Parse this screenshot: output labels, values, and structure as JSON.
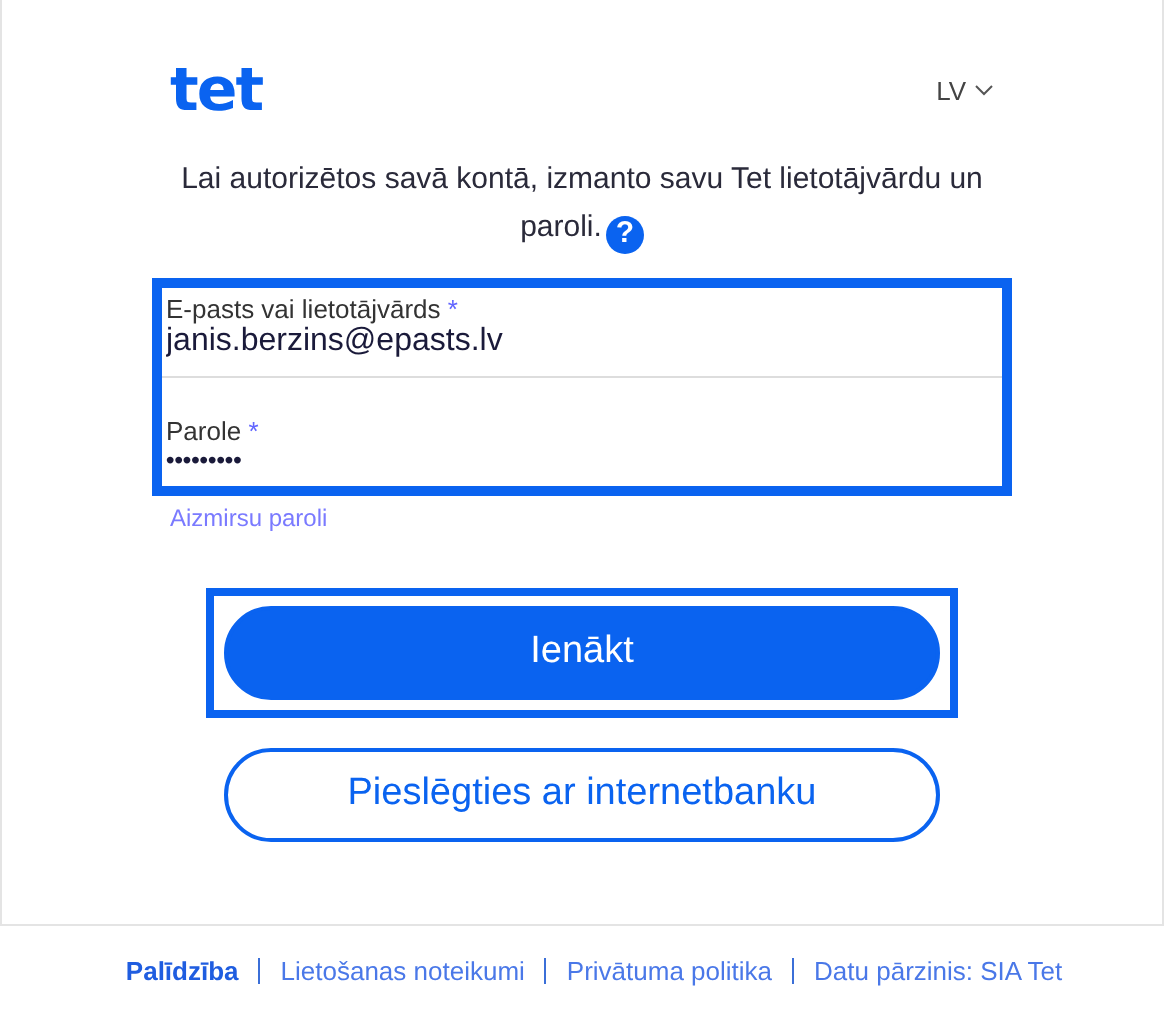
{
  "header": {
    "logo": "tet",
    "language": "LV"
  },
  "intro": {
    "text": "Lai autorizētos savā kontā, izmanto savu Tet lietotājvārdu un paroli.",
    "help_icon": "?"
  },
  "form": {
    "highlighted": true,
    "fields": [
      {
        "kind": "text",
        "label": "E-pasts vai lietotājvārds",
        "required_mark": "*",
        "value": "janis.berzins@epasts.lv"
      },
      {
        "kind": "password",
        "label": "Parole",
        "required_mark": "*",
        "value": "•••••••••"
      }
    ],
    "forgot_link": "Aizmirsu paroli"
  },
  "buttons": [
    {
      "kind": "primary",
      "label": "Ienākt",
      "highlighted": true
    },
    {
      "kind": "secondary",
      "label": "Pieslēgties ar internetbanku",
      "highlighted": false
    }
  ],
  "footer_links": [
    {
      "label": "Palīdzība",
      "selected": true
    },
    {
      "label": "Lietošanas noteikumi",
      "selected": false
    },
    {
      "label": "Privātuma politika",
      "selected": false
    },
    {
      "label": "Datu pārzinis: SIA Tet",
      "selected": false
    }
  ]
}
